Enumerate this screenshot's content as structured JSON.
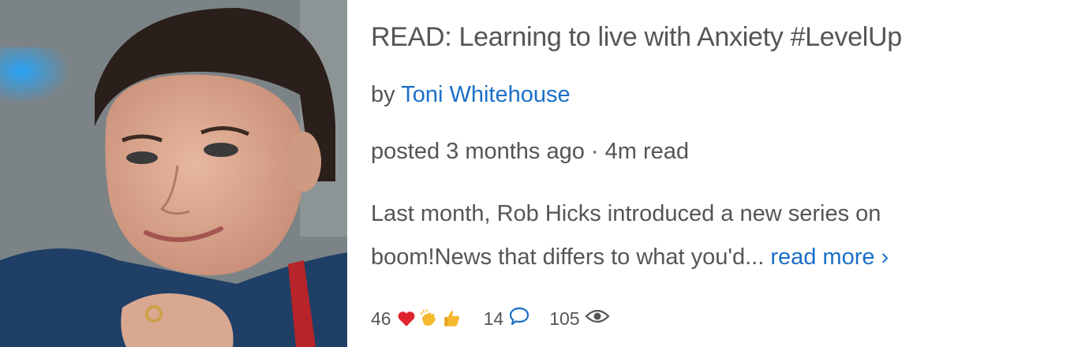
{
  "post": {
    "title": "READ: Learning to live with Anxiety #LevelUp",
    "by_prefix": "by",
    "author": "Toni Whitehouse",
    "posted": "posted 3 months ago",
    "separator": "·",
    "read_time": "4m read",
    "excerpt": "Last month, Rob Hicks introduced a new series on boom!News that differs to what you'd...",
    "read_more": "read more ›"
  },
  "stats": {
    "reactions": "46",
    "reaction_icons": [
      "heart-icon",
      "clapping-hands-icon",
      "thumbs-up-icon"
    ],
    "comments": "14",
    "views": "105"
  },
  "colors": {
    "link": "#1a6fc8",
    "text": "#555555",
    "heart": "#e0242f",
    "emoji_yellow": "#f5b82e"
  }
}
